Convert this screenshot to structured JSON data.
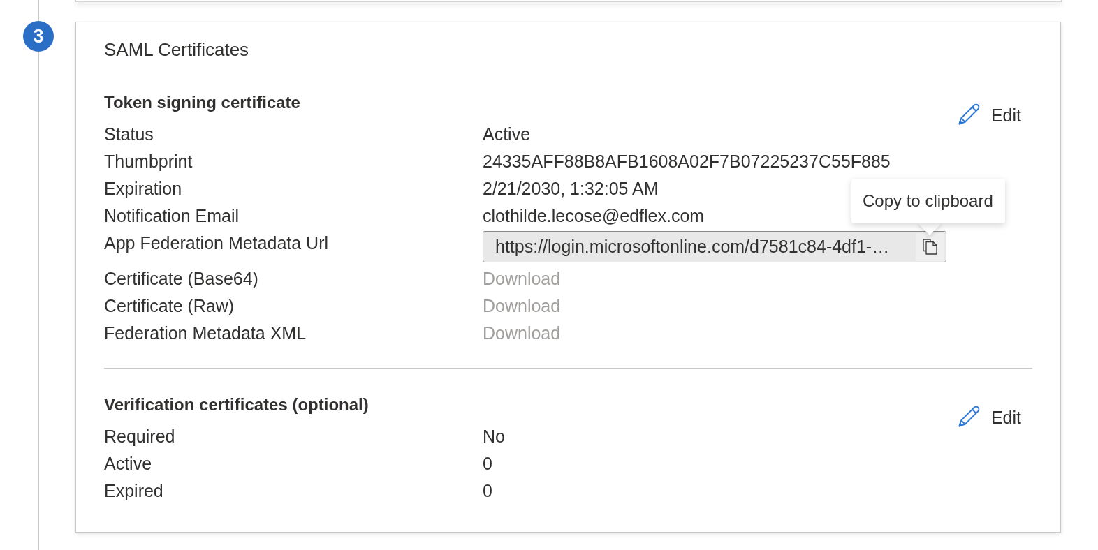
{
  "step": {
    "number": "3"
  },
  "card": {
    "title": "SAML Certificates",
    "sections": [
      {
        "heading": "Token signing certificate",
        "edit_label": "Edit",
        "rows": [
          {
            "kind": "text",
            "label": "Status",
            "value": "Active"
          },
          {
            "kind": "text",
            "label": "Thumbprint",
            "value": "24335AFF88B8AFB1608A02F7B07225237C55F885"
          },
          {
            "kind": "text",
            "label": "Expiration",
            "value": "2/21/2030, 1:32:05 AM"
          },
          {
            "kind": "text",
            "label": "Notification Email",
            "value": "clothilde.lecose@edflex.com"
          },
          {
            "kind": "copy_field",
            "label": "App Federation Metadata Url",
            "value": "https://login.microsoftonline.com/d7581c84-4df1-…",
            "tooltip": "Copy to clipboard"
          },
          {
            "kind": "link",
            "label": "Certificate (Base64)",
            "value": "Download",
            "disabled": true
          },
          {
            "kind": "link",
            "label": "Certificate (Raw)",
            "value": "Download",
            "disabled": true
          },
          {
            "kind": "link",
            "label": "Federation Metadata XML",
            "value": "Download",
            "disabled": true
          }
        ]
      },
      {
        "heading": "Verification certificates (optional)",
        "edit_label": "Edit",
        "rows": [
          {
            "kind": "text",
            "label": "Required",
            "value": "No"
          },
          {
            "kind": "text",
            "label": "Active",
            "value": "0"
          },
          {
            "kind": "text",
            "label": "Expired",
            "value": "0"
          }
        ]
      }
    ]
  }
}
